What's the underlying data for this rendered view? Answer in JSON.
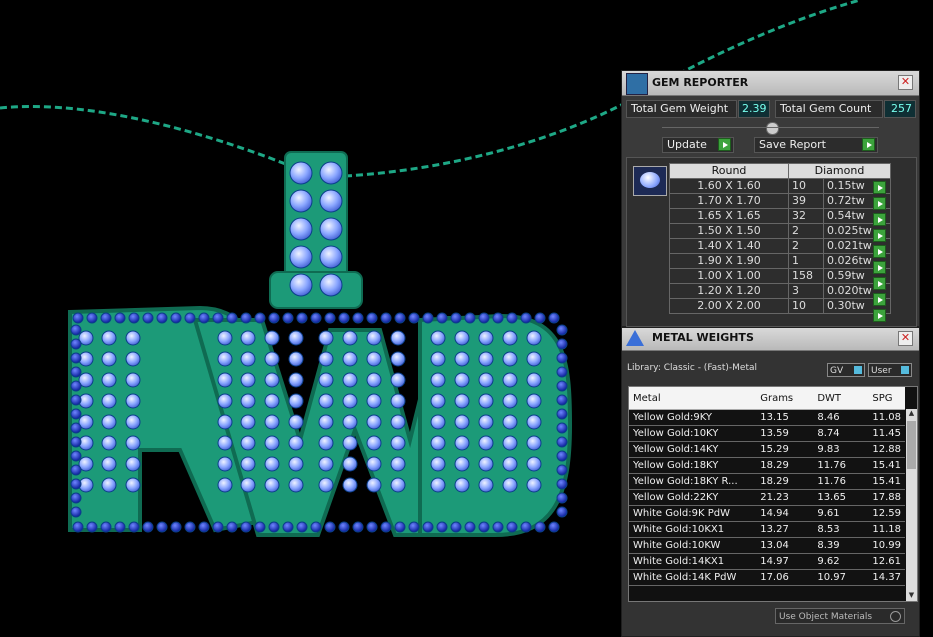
{
  "gem_reporter": {
    "title": "GEM REPORTER",
    "total_gem_weight_label": "Total Gem Weight",
    "total_gem_weight_value": "2.39",
    "total_gem_count_label": "Total Gem Count",
    "total_gem_count_value": "257",
    "update_label": "Update",
    "save_report_label": "Save Report",
    "table_headers": [
      "Round",
      "Diamond"
    ],
    "rows": [
      {
        "size": "1.60 X 1.60",
        "count": "10",
        "weight": "0.15tw"
      },
      {
        "size": "1.70 X 1.70",
        "count": "39",
        "weight": "0.72tw"
      },
      {
        "size": "1.65 X 1.65",
        "count": "32",
        "weight": "0.54tw"
      },
      {
        "size": "1.50 X 1.50",
        "count": "2",
        "weight": "0.025tw"
      },
      {
        "size": "1.40 X 1.40",
        "count": "2",
        "weight": "0.021tw"
      },
      {
        "size": "1.90 X 1.90",
        "count": "1",
        "weight": "0.026tw"
      },
      {
        "size": "1.00 X 1.00",
        "count": "158",
        "weight": "0.59tw"
      },
      {
        "size": "1.20 X 1.20",
        "count": "3",
        "weight": "0.020tw"
      },
      {
        "size": "2.00 X 2.00",
        "count": "10",
        "weight": "0.30tw"
      }
    ]
  },
  "metal_weights": {
    "title": "METAL WEIGHTS",
    "library_label": "Library: Classic - (Fast)-Metal",
    "gv_label": "GV",
    "user_label": "User",
    "headers": [
      "Metal",
      "Grams",
      "DWT",
      "SPG"
    ],
    "rows": [
      {
        "metal": "Yellow Gold:9KY",
        "grams": "13.15",
        "dwt": "8.46",
        "spg": "11.08"
      },
      {
        "metal": "Yellow Gold:10KY",
        "grams": "13.59",
        "dwt": "8.74",
        "spg": "11.45"
      },
      {
        "metal": "Yellow Gold:14KY",
        "grams": "15.29",
        "dwt": "9.83",
        "spg": "12.88"
      },
      {
        "metal": "Yellow Gold:18KY",
        "grams": "18.29",
        "dwt": "11.76",
        "spg": "15.41"
      },
      {
        "metal": "Yellow Gold:18KY R...",
        "grams": "18.29",
        "dwt": "11.76",
        "spg": "15.41"
      },
      {
        "metal": "Yellow Gold:22KY",
        "grams": "21.23",
        "dwt": "13.65",
        "spg": "17.88"
      },
      {
        "metal": "White Gold:9K PdW",
        "grams": "14.94",
        "dwt": "9.61",
        "spg": "12.59"
      },
      {
        "metal": "White Gold:10KX1",
        "grams": "13.27",
        "dwt": "8.53",
        "spg": "11.18"
      },
      {
        "metal": "White Gold:10KW",
        "grams": "13.04",
        "dwt": "8.39",
        "spg": "10.99"
      },
      {
        "metal": "White Gold:14KX1",
        "grams": "14.97",
        "dwt": "9.62",
        "spg": "12.61"
      },
      {
        "metal": "White Gold:14K PdW",
        "grams": "17.06",
        "dwt": "10.97",
        "spg": "14.37"
      }
    ],
    "use_object_materials_label": "Use Object Materials"
  },
  "colors": {
    "metal": "#1c9a78",
    "metal_dark": "#0f6b52",
    "gem_light": "#8aa6ff",
    "gem_dark": "#1a2fb5"
  },
  "icons": [
    "gem-reporter-icon",
    "close-icon",
    "round-gem-icon",
    "metal-weights-icon",
    "play-arrow-icon"
  ]
}
